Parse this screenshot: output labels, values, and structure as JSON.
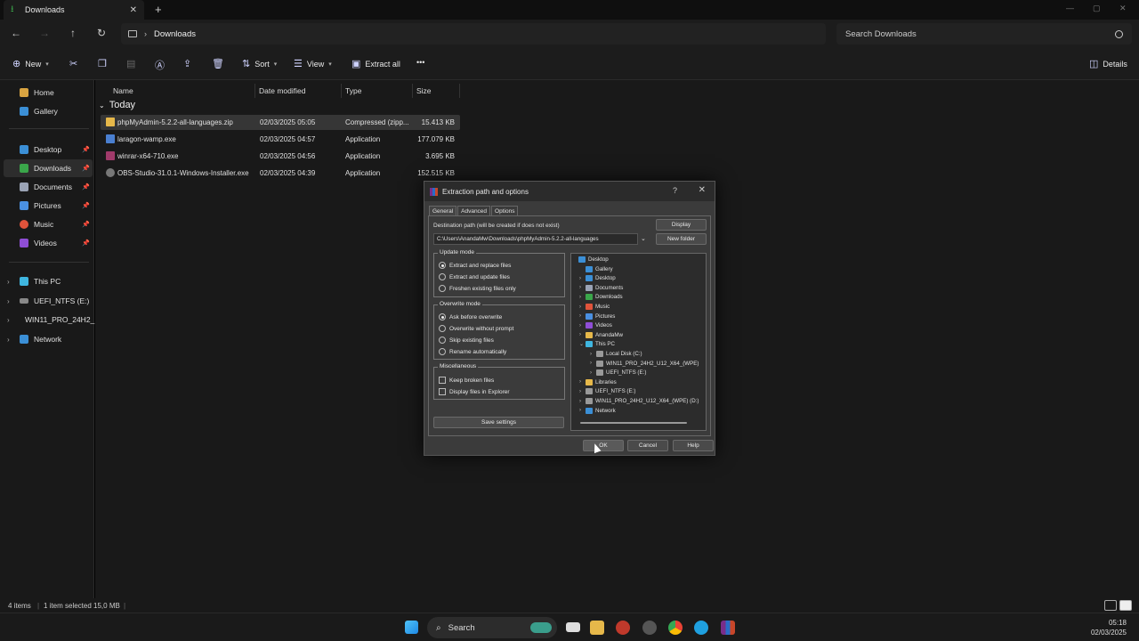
{
  "window": {
    "tab_title": "Downloads",
    "tab_close": "✕",
    "new_tab": "+",
    "controls": [
      "—",
      "▢",
      "✕"
    ]
  },
  "address": {
    "crumb": "Downloads",
    "search_placeholder": "Search Downloads"
  },
  "commands": {
    "new": "New",
    "sort": "Sort",
    "view": "View",
    "extract_all": "Extract all",
    "more": "•••",
    "details": "Details"
  },
  "sidebar": {
    "items": [
      {
        "label": "Home",
        "color": "#d9a441"
      },
      {
        "label": "Gallery",
        "color": "#3b8fd6"
      },
      {
        "label": "Desktop",
        "color": "#3b8fd6"
      },
      {
        "label": "Downloads",
        "color": "#3aa64a"
      },
      {
        "label": "Documents",
        "color": "#9aa3b5"
      },
      {
        "label": "Pictures",
        "color": "#4a90e2"
      },
      {
        "label": "Music",
        "color": "#e0533b"
      },
      {
        "label": "Videos",
        "color": "#8f4ed6"
      },
      {
        "label": "This PC",
        "color": "#3fb6e0"
      },
      {
        "label": "UEFI_NTFS (E:)",
        "color": "#888888"
      },
      {
        "label": "WIN11_PRO_24H2_",
        "color": "#888888"
      },
      {
        "label": "Network",
        "color": "#3b8fd6"
      }
    ]
  },
  "files": {
    "columns": [
      "Name",
      "Date modified",
      "Type",
      "Size"
    ],
    "group": "Today",
    "rows": [
      {
        "name": "phpMyAdmin-5.2.2-all-languages.zip",
        "date": "02/03/2025 05:05",
        "type": "Compressed (zipp...",
        "size": "15.413 KB",
        "icon": "#e6b84a"
      },
      {
        "name": "laragon-wamp.exe",
        "date": "02/03/2025 04:57",
        "type": "Application",
        "size": "177.079 KB",
        "icon": "#4a7fd0"
      },
      {
        "name": "winrar-x64-710.exe",
        "date": "02/03/2025 04:56",
        "type": "Application",
        "size": "3.695 KB",
        "icon": "#a03a6a"
      },
      {
        "name": "OBS-Studio-31.0.1-Windows-Installer.exe",
        "date": "02/03/2025 04:39",
        "type": "Application",
        "size": "152.515 KB",
        "icon": "#777777"
      }
    ]
  },
  "status": {
    "items": "4 items",
    "selected": "1 item selected  15,0 MB"
  },
  "taskbar": {
    "search": "Search",
    "time": "05:18",
    "date": "02/03/2025"
  },
  "dialog": {
    "title": "Extraction path and options",
    "help_glyph": "?",
    "tabs": [
      "General",
      "Advanced",
      "Options"
    ],
    "dest_label": "Destination path (will be created if does not exist)",
    "dest_value": "C:\\Users\\AnandaMw\\Downloads\\phpMyAdmin-5.2.2-all-languages",
    "display_btn": "Display",
    "new_folder_btn": "New folder",
    "update_mode": {
      "legend": "Update mode",
      "options": [
        "Extract and replace files",
        "Extract and update files",
        "Freshen existing files only"
      ],
      "selected": 0
    },
    "overwrite_mode": {
      "legend": "Overwrite mode",
      "options": [
        "Ask before overwrite",
        "Overwrite without prompt",
        "Skip existing files",
        "Rename automatically"
      ],
      "selected": 0
    },
    "misc": {
      "legend": "Miscellaneous",
      "options": [
        "Keep broken files",
        "Display files in Explorer"
      ]
    },
    "save_settings": "Save settings",
    "tree": [
      {
        "label": "Desktop",
        "exp": "",
        "color": "#3b8fd6"
      },
      {
        "label": "Gallery",
        "exp": "",
        "color": "#3b8fd6"
      },
      {
        "label": "Desktop",
        "exp": ">",
        "color": "#3b8fd6"
      },
      {
        "label": "Documents",
        "exp": ">",
        "color": "#9aa3b5"
      },
      {
        "label": "Downloads",
        "exp": ">",
        "color": "#3aa64a"
      },
      {
        "label": "Music",
        "exp": ">",
        "color": "#e0533b"
      },
      {
        "label": "Pictures",
        "exp": ">",
        "color": "#4a90e2"
      },
      {
        "label": "Videos",
        "exp": ">",
        "color": "#8f4ed6"
      },
      {
        "label": "AnandaMw",
        "exp": ">",
        "color": "#e6b84a"
      },
      {
        "label": "This PC",
        "exp": "v",
        "color": "#3fb6e0"
      },
      {
        "label": "Local Disk (C:)",
        "exp": ">",
        "color": "#999999"
      },
      {
        "label": "WIN11_PRO_24H2_U12_X64_(WPE)",
        "exp": ">",
        "color": "#999999"
      },
      {
        "label": "UEFI_NTFS (E:)",
        "exp": ">",
        "color": "#999999"
      },
      {
        "label": "Libraries",
        "exp": ">",
        "color": "#e6b84a"
      },
      {
        "label": "UEFI_NTFS (E:)",
        "exp": ">",
        "color": "#999999"
      },
      {
        "label": "WIN11_PRO_24H2_U12_X64_(WPE) (D:)",
        "exp": ">",
        "color": "#999999"
      },
      {
        "label": "Network",
        "exp": ">",
        "color": "#3b8fd6"
      }
    ],
    "ok": "OK",
    "cancel": "Cancel",
    "help": "Help"
  }
}
